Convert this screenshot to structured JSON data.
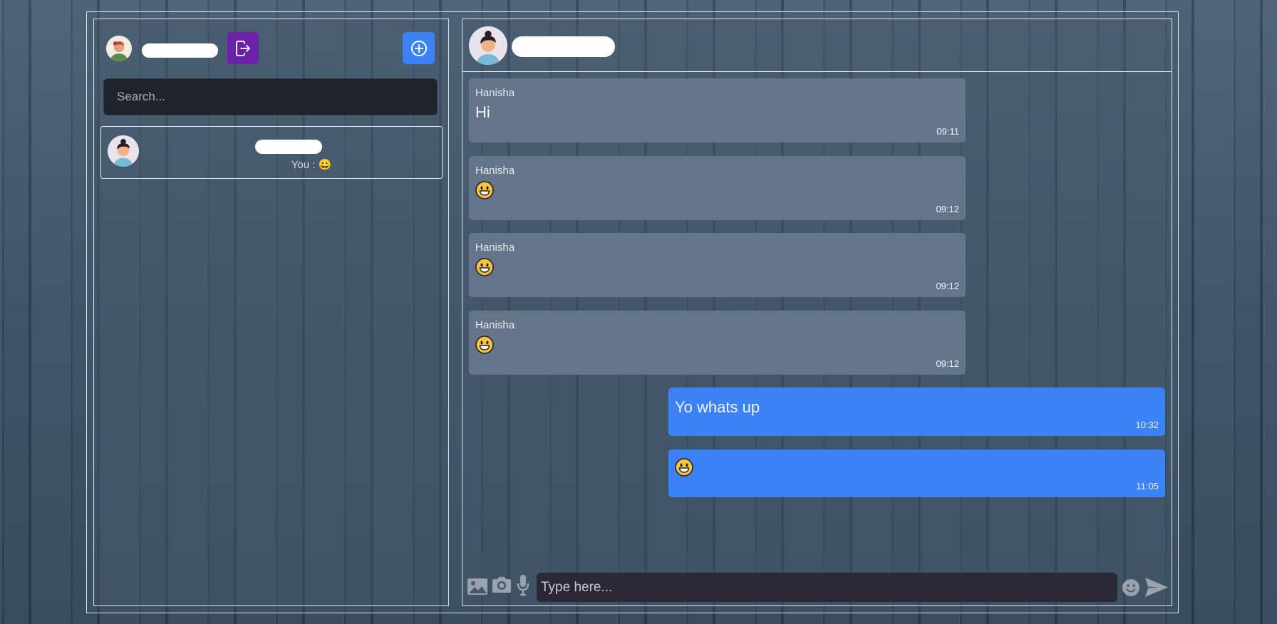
{
  "colors": {
    "logout_button": "#6b21a8",
    "new_chat_button": "#3b82f6",
    "incoming_bubble": "#64748b",
    "outgoing_bubble": "#3b82f6",
    "search_bg": "#1e232c",
    "composer_bg": "#2a2834"
  },
  "sidebar": {
    "user_avatar_icon": "user-avatar-icon",
    "logout_icon": "logout-icon",
    "new_chat_icon": "plus-circle-icon",
    "search": {
      "placeholder": "Search...",
      "value": ""
    },
    "conversations": [
      {
        "avatar_icon": "contact-avatar-icon",
        "preview": "You : 😀"
      }
    ]
  },
  "chat": {
    "header": {
      "avatar_icon": "contact-avatar-icon"
    },
    "messages": [
      {
        "direction": "in",
        "sender": "Hanisha",
        "text": "Hi",
        "time": "09:11"
      },
      {
        "direction": "in",
        "sender": "Hanisha",
        "emoji": "grinning-face",
        "time": "09:12"
      },
      {
        "direction": "in",
        "sender": "Hanisha",
        "emoji": "grinning-face",
        "time": "09:12"
      },
      {
        "direction": "in",
        "sender": "Hanisha",
        "emoji": "grinning-face",
        "time": "09:12"
      },
      {
        "direction": "out",
        "text": "Yo whats up",
        "time": "10:32"
      },
      {
        "direction": "out",
        "emoji": "grinning-face",
        "time": "11:05"
      }
    ],
    "composer": {
      "placeholder": "Type here...",
      "value": "",
      "icons": [
        "image-icon",
        "camera-icon",
        "microphone-icon",
        "emoji-icon",
        "send-icon"
      ]
    }
  }
}
